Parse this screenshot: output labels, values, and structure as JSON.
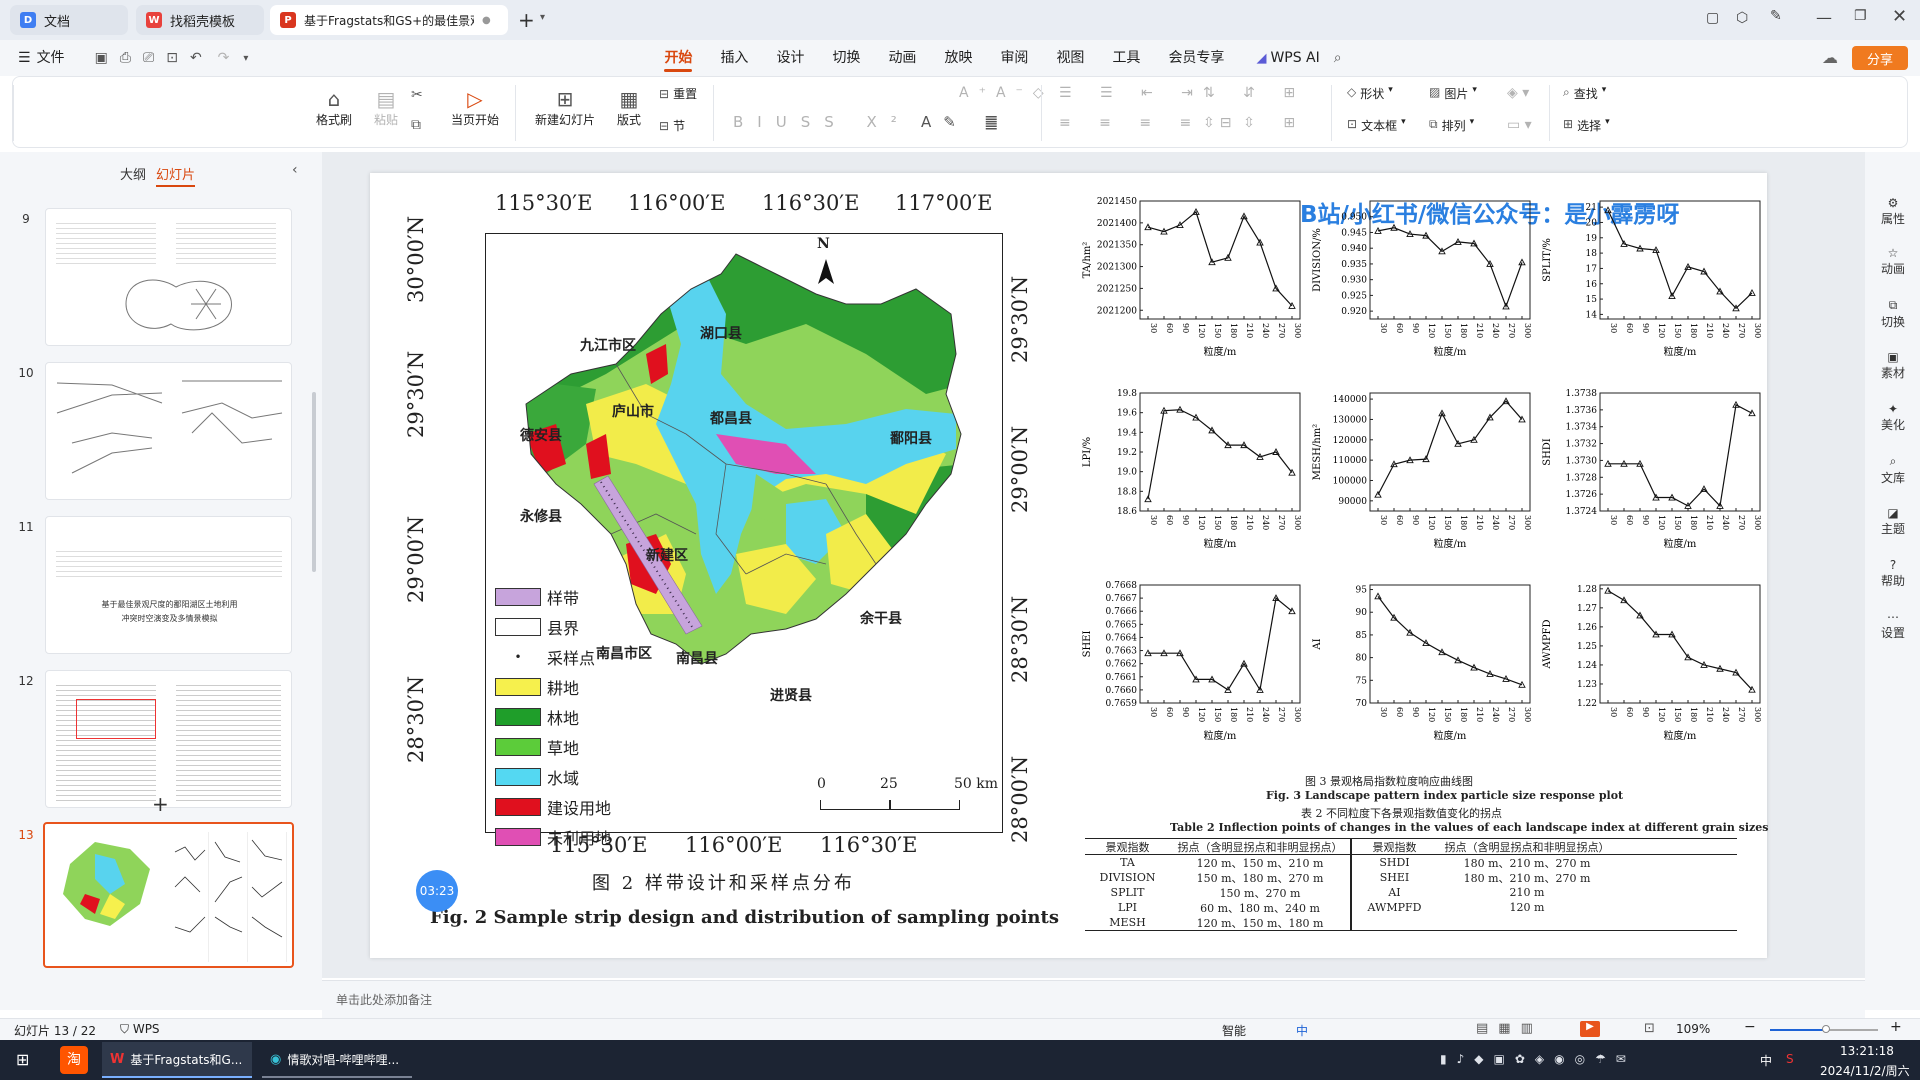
{
  "tabs": {
    "t1": "文档",
    "t2": "找稻壳模板",
    "t3": "基于Fragstats和GS+的最佳景观..."
  },
  "menu": {
    "file": "文件",
    "items": [
      "开始",
      "插入",
      "设计",
      "切换",
      "动画",
      "放映",
      "审阅",
      "视图",
      "工具",
      "会员专享"
    ],
    "ai": "WPS AI",
    "share": "分享"
  },
  "ribbon": {
    "format_painter": "格式刷",
    "paste": "粘贴",
    "from_current": "当页开始",
    "new_slide": "新建幻灯片",
    "layout": "版式",
    "section": "节",
    "reset": "重置",
    "shape": "形状",
    "picture": "图片",
    "textbox": "文本框",
    "arrange": "排列",
    "find": "查找",
    "select": "选择"
  },
  "panel": {
    "outline": "大纲",
    "slides": "幻灯片",
    "add": "+"
  },
  "thumbs": [
    {
      "num": "9"
    },
    {
      "num": "10"
    },
    {
      "num": "11",
      "text1": "基于最佳景观尺度的鄱阳湖区土地利用",
      "text2": "冲突时空演变及多情景模拟"
    },
    {
      "num": "12"
    },
    {
      "num": "13"
    }
  ],
  "rightbar": [
    "属性",
    "动画",
    "切换",
    "素材",
    "美化",
    "文库",
    "主题",
    "帮助",
    "设置"
  ],
  "slide": {
    "watermark": "B站/小红书/微信公众号：是小霹雳呀",
    "map": {
      "top_lon": [
        "115°30′E",
        "116°00′E",
        "116°30′E",
        "117°00′E"
      ],
      "bottom_lon": [
        "115°30′E",
        "116°00′E",
        "116°30′E"
      ],
      "left_lat": [
        "30°00′N",
        "29°30′N",
        "29°00′N",
        "28°30′N"
      ],
      "right_lat": [
        "29°30′N",
        "29°00′N",
        "28°30′N",
        "28°00′N"
      ],
      "north": "N",
      "places": [
        "湖口县",
        "九江市区",
        "庐山市",
        "德安县",
        "都昌县",
        "鄱阳县",
        "永修县",
        "新建区",
        "余干县",
        "南昌县",
        "南昌市区",
        "进贤县"
      ],
      "legend": [
        "样带",
        "县界",
        "采样点",
        "耕地",
        "林地",
        "草地",
        "水域",
        "建设用地",
        "未利用地"
      ],
      "legend_colors": [
        "#c7a4dc",
        "#ffffff",
        "#000000",
        "#f6f04d",
        "#1f9e2a",
        "#5ccc3a",
        "#54d8f2",
        "#e0101e",
        "#e04fb4"
      ],
      "scale": [
        "0",
        "25",
        "50 km"
      ],
      "caption_cn": "图 2   样带设计和采样点分布",
      "caption_en": "Fig. 2   Sample strip design and distribution of sampling points",
      "timer": "03:23"
    },
    "chart_data": [
      {
        "type": "line",
        "ylabel": "TA/hm²",
        "xlabel": "粒度/m",
        "x": [
          30,
          60,
          90,
          120,
          150,
          180,
          210,
          240,
          270,
          300
        ],
        "values": [
          2021390,
          2021380,
          2021395,
          2021425,
          2021310,
          2021320,
          2021415,
          2021355,
          2021250,
          2021210
        ],
        "ylim": [
          2021180,
          2021450
        ],
        "yticks": [
          "2021450",
          "2021400",
          "2021350",
          "2021300",
          "2021250",
          "2021200"
        ]
      },
      {
        "type": "line",
        "ylabel": "DIVISION/%",
        "xlabel": "粒度/m",
        "x": [
          30,
          60,
          90,
          120,
          150,
          180,
          210,
          240,
          270,
          300
        ],
        "values": [
          0.9455,
          0.9465,
          0.9445,
          0.944,
          0.939,
          0.942,
          0.9415,
          0.935,
          0.9215,
          0.9355
        ],
        "ylim": [
          0.9175,
          0.955
        ],
        "yticks": [
          "0.950",
          "0.945",
          "0.940",
          "0.935",
          "0.930",
          "0.925",
          "0.920"
        ]
      },
      {
        "type": "line",
        "ylabel": "SPLIT/%",
        "xlabel": "粒度/m",
        "x": [
          30,
          60,
          90,
          120,
          150,
          180,
          210,
          240,
          270,
          300
        ],
        "values": [
          20.8,
          18.6,
          18.3,
          18.2,
          15.2,
          17.1,
          16.8,
          15.5,
          14.4,
          15.4
        ],
        "ylim": [
          13.7,
          21.4
        ],
        "yticks": [
          "21",
          "20",
          "19",
          "18",
          "17",
          "16",
          "15",
          "14"
        ]
      },
      {
        "type": "line",
        "ylabel": "LPI/%",
        "xlabel": "粒度/m",
        "x": [
          30,
          60,
          90,
          120,
          150,
          180,
          210,
          240,
          270,
          300
        ],
        "values": [
          18.72,
          19.62,
          19.63,
          19.55,
          19.42,
          19.27,
          19.27,
          19.15,
          19.2,
          18.99
        ],
        "ylim": [
          18.6,
          19.8
        ],
        "yticks": [
          "19.8",
          "19.6",
          "19.4",
          "19.2",
          "19.0",
          "18.8",
          "18.6"
        ]
      },
      {
        "type": "line",
        "ylabel": "MESH/hm²",
        "xlabel": "粒度/m",
        "x": [
          30,
          60,
          90,
          120,
          150,
          180,
          210,
          240,
          270,
          300
        ],
        "values": [
          93000,
          108000,
          110000,
          110500,
          133000,
          118000,
          120000,
          131000,
          139000,
          130000
        ],
        "ylim": [
          85000,
          143000
        ],
        "yticks": [
          "140000",
          "130000",
          "120000",
          "110000",
          "100000",
          "90000"
        ]
      },
      {
        "type": "line",
        "ylabel": "SHDI",
        "xlabel": "粒度/m",
        "x": [
          30,
          60,
          90,
          120,
          150,
          180,
          210,
          240,
          270,
          300
        ],
        "values": [
          1.37296,
          1.37296,
          1.37296,
          1.37256,
          1.37256,
          1.37246,
          1.37266,
          1.37246,
          1.37366,
          1.37356
        ],
        "ylim": [
          1.3724,
          1.3738
        ],
        "yticks": [
          "1.3738",
          "1.3736",
          "1.3734",
          "1.3732",
          "1.3730",
          "1.3728",
          "1.3726",
          "1.3724"
        ]
      },
      {
        "type": "line",
        "ylabel": "SHEI",
        "xlabel": "粒度/m",
        "x": [
          30,
          60,
          90,
          120,
          150,
          180,
          210,
          240,
          270,
          300
        ],
        "values": [
          0.76628,
          0.76628,
          0.76628,
          0.76608,
          0.76608,
          0.766,
          0.7662,
          0.766,
          0.7667,
          0.7666
        ],
        "ylim": [
          0.7659,
          0.7668
        ],
        "yticks": [
          "0.7668",
          "0.7667",
          "0.7666",
          "0.7665",
          "0.7664",
          "0.7663",
          "0.7662",
          "0.7661",
          "0.7660",
          "0.7659"
        ]
      },
      {
        "type": "line",
        "ylabel": "AI",
        "xlabel": "粒度/m",
        "x": [
          30,
          60,
          90,
          120,
          150,
          180,
          210,
          240,
          270,
          300
        ],
        "values": [
          93.5,
          88.8,
          85.5,
          83.2,
          81.2,
          79.4,
          77.8,
          76.4,
          75.3,
          74.0
        ],
        "ylim": [
          70,
          96
        ],
        "yticks": [
          "95",
          "90",
          "85",
          "80",
          "75",
          "70"
        ]
      },
      {
        "type": "line",
        "ylabel": "AWMPFD",
        "xlabel": "粒度/m",
        "x": [
          30,
          60,
          90,
          120,
          150,
          180,
          210,
          240,
          270,
          300
        ],
        "values": [
          1.279,
          1.274,
          1.266,
          1.256,
          1.256,
          1.244,
          1.24,
          1.238,
          1.236,
          1.227
        ],
        "ylim": [
          1.22,
          1.282
        ],
        "yticks": [
          "1.28",
          "1.27",
          "1.26",
          "1.25",
          "1.24",
          "1.23",
          "1.22"
        ]
      }
    ],
    "fig3_cn": "图 3   景观格局指数粒度响应曲线图",
    "fig3_en": "Fig. 3   Landscape pattern index particle size response plot",
    "table_cn": "表 2   不同粒度下各景观指数值变化的拐点",
    "table_en": "Table 2   Inflection points of changes in the values of each landscape index at different grain sizes",
    "table_headers": [
      "景观指数",
      "拐点（含明显拐点和非明显拐点）",
      "景观指数",
      "拐点（含明显拐点和非明显拐点）"
    ],
    "table_rows": [
      [
        "TA",
        "120 m、150 m、210 m",
        "SHDI",
        "180 m、210 m、270 m"
      ],
      [
        "DIVISION",
        "150 m、180 m、270 m",
        "SHEI",
        "180 m、210 m、270 m"
      ],
      [
        "SPLIT",
        "150 m、270 m",
        "AI",
        "210 m"
      ],
      [
        "LPI",
        "60 m、180 m、240 m",
        "AWMPFD",
        "120 m"
      ],
      [
        "MESH",
        "120 m、150 m、180 m",
        "",
        ""
      ]
    ]
  },
  "notes": "单击此处添加备注",
  "status": {
    "slide": "幻灯片 13 / 22",
    "wps": "WPS",
    "smart": "智能",
    "zoom": "109%",
    "ime": "中"
  },
  "taskbar": {
    "app1": "基于Fragstats和G...",
    "app2": "情歌对唱-哔哩哔哩...",
    "time": "13:21:18",
    "date": "2024/11/2/周六",
    "lang": "中"
  }
}
